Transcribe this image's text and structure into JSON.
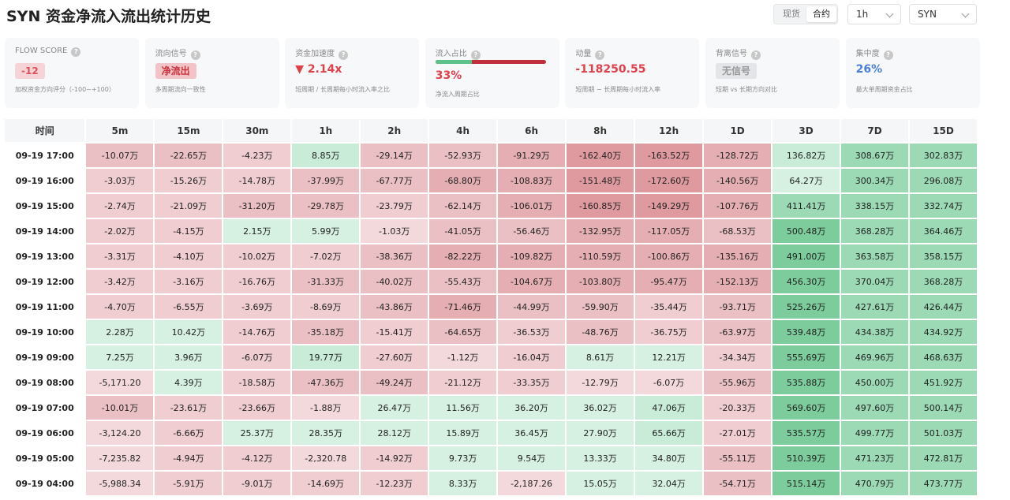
{
  "header": {
    "title": "SYN 资金净流入流出统计历史",
    "market_tabs": [
      "现货",
      "合约"
    ],
    "active_market": 1,
    "interval": "1h",
    "symbol": "SYN"
  },
  "cards": [
    {
      "label": "FLOW SCORE",
      "value": "-12",
      "sub": "加权资金方向评分（-100~+100）",
      "kind": "badge",
      "color": "#e0505a",
      "bg": "#f6d3d6"
    },
    {
      "label": "流向信号",
      "value": "净流出",
      "sub": "多周期流向一致性",
      "kind": "badge",
      "color": "#c8303a",
      "bg": "#f3c4c7"
    },
    {
      "label": "资金加速度",
      "value": "▼ 2.14x",
      "sub": "短周期 / 长周期每小时流入率之比",
      "kind": "text",
      "color": "#e0404a"
    },
    {
      "label": "流入占比",
      "value": "33%",
      "sub": "净流入周期占比",
      "kind": "ratio",
      "color": "#e0404a",
      "ratio": 0.33
    },
    {
      "label": "动量",
      "value": "-118250.55",
      "sub": "短周期 − 长周期每小时流入率",
      "kind": "text",
      "color": "#e0404a"
    },
    {
      "label": "背离信号",
      "value": "无信号",
      "sub": "短期 vs 长期方向对比",
      "kind": "badge",
      "color": "#999999",
      "bg": "#e4e5e8"
    },
    {
      "label": "集中度",
      "value": "26%",
      "sub": "最大单周期资金占比",
      "kind": "text",
      "color": "#4a7fd6"
    }
  ],
  "table": {
    "headers": [
      "时间",
      "5m",
      "15m",
      "30m",
      "1h",
      "2h",
      "4h",
      "6h",
      "8h",
      "12h",
      "1D",
      "3D",
      "7D",
      "15D"
    ],
    "rows": [
      {
        "time": "09-19 17:00",
        "cells": [
          "-10.07万",
          "-22.65万",
          "-4.23万",
          "8.85万",
          "-29.14万",
          "-52.93万",
          "-91.29万",
          "-162.40万",
          "-163.52万",
          "-128.72万",
          "136.82万",
          "308.67万",
          "302.83万"
        ],
        "levels": [
          -3,
          -3,
          -2,
          2,
          -3,
          -3,
          -4,
          -5,
          -5,
          -4,
          2,
          4,
          4
        ]
      },
      {
        "time": "09-19 16:00",
        "cells": [
          "-3.03万",
          "-15.26万",
          "-14.78万",
          "-37.99万",
          "-67.77万",
          "-68.80万",
          "-108.83万",
          "-151.48万",
          "-172.60万",
          "-140.56万",
          "64.27万",
          "300.34万",
          "296.08万"
        ],
        "levels": [
          -2,
          -2,
          -2,
          -3,
          -3,
          -4,
          -4,
          -5,
          -5,
          -4,
          1,
          4,
          4
        ]
      },
      {
        "time": "09-19 15:00",
        "cells": [
          "-2.74万",
          "-21.09万",
          "-31.20万",
          "-29.78万",
          "-23.79万",
          "-62.14万",
          "-106.01万",
          "-160.85万",
          "-149.29万",
          "-107.76万",
          "411.41万",
          "338.15万",
          "332.74万"
        ],
        "levels": [
          -2,
          -2,
          -3,
          -3,
          -2,
          -3,
          -4,
          -5,
          -5,
          -4,
          4,
          4,
          4
        ]
      },
      {
        "time": "09-19 14:00",
        "cells": [
          "-2.02万",
          "-4.15万",
          "2.15万",
          "5.99万",
          "-1.03万",
          "-41.05万",
          "-56.46万",
          "-132.95万",
          "-117.05万",
          "-68.53万",
          "500.48万",
          "368.28万",
          "364.46万"
        ],
        "levels": [
          -2,
          -2,
          1,
          1,
          -1,
          -3,
          -3,
          -4,
          -4,
          -3,
          5,
          4,
          4
        ]
      },
      {
        "time": "09-19 13:00",
        "cells": [
          "-3.31万",
          "-4.10万",
          "-10.02万",
          "-7.02万",
          "-38.36万",
          "-82.22万",
          "-109.82万",
          "-110.59万",
          "-100.86万",
          "-135.16万",
          "491.00万",
          "363.58万",
          "358.15万"
        ],
        "levels": [
          -2,
          -2,
          -2,
          -2,
          -3,
          -4,
          -4,
          -4,
          -4,
          -4,
          5,
          4,
          4
        ]
      },
      {
        "time": "09-19 12:00",
        "cells": [
          "-3.42万",
          "-3.16万",
          "-16.76万",
          "-31.33万",
          "-40.02万",
          "-55.43万",
          "-104.67万",
          "-103.80万",
          "-95.47万",
          "-152.13万",
          "456.30万",
          "370.04万",
          "368.28万"
        ],
        "levels": [
          -2,
          -2,
          -2,
          -3,
          -3,
          -3,
          -4,
          -4,
          -4,
          -4,
          5,
          4,
          4
        ]
      },
      {
        "time": "09-19 11:00",
        "cells": [
          "-4.70万",
          "-6.55万",
          "-3.69万",
          "-8.69万",
          "-43.86万",
          "-71.46万",
          "-44.99万",
          "-59.90万",
          "-35.44万",
          "-93.71万",
          "525.26万",
          "427.61万",
          "426.44万"
        ],
        "levels": [
          -2,
          -2,
          -2,
          -2,
          -3,
          -4,
          -3,
          -3,
          -2,
          -3,
          5,
          4,
          4
        ]
      },
      {
        "time": "09-19 10:00",
        "cells": [
          "2.28万",
          "10.42万",
          "-14.76万",
          "-35.18万",
          "-15.41万",
          "-64.65万",
          "-36.53万",
          "-48.76万",
          "-36.75万",
          "-63.97万",
          "539.48万",
          "434.38万",
          "434.92万"
        ],
        "levels": [
          1,
          1,
          -2,
          -3,
          -2,
          -3,
          -2,
          -3,
          -2,
          -3,
          5,
          4,
          4
        ]
      },
      {
        "time": "09-19 09:00",
        "cells": [
          "7.25万",
          "3.96万",
          "-6.07万",
          "19.77万",
          "-27.60万",
          "-1.12万",
          "-16.04万",
          "8.61万",
          "12.21万",
          "-34.34万",
          "555.69万",
          "469.96万",
          "468.63万"
        ],
        "levels": [
          1,
          1,
          -2,
          2,
          -2,
          -1,
          -2,
          1,
          1,
          -2,
          5,
          4,
          4
        ]
      },
      {
        "time": "09-19 08:00",
        "cells": [
          "-5,171.20",
          "4.39万",
          "-18.58万",
          "-47.36万",
          "-49.24万",
          "-21.12万",
          "-33.35万",
          "-12.79万",
          "-6.07万",
          "-55.96万",
          "535.88万",
          "450.00万",
          "451.92万"
        ],
        "levels": [
          -1,
          1,
          -2,
          -3,
          -3,
          -2,
          -2,
          -1,
          -1,
          -3,
          5,
          4,
          4
        ]
      },
      {
        "time": "09-19 07:00",
        "cells": [
          "-10.01万",
          "-23.61万",
          "-23.66万",
          "-1.88万",
          "26.47万",
          "11.56万",
          "36.20万",
          "36.02万",
          "47.06万",
          "-20.33万",
          "569.60万",
          "497.60万",
          "500.14万"
        ],
        "levels": [
          -3,
          -2,
          -2,
          -1,
          1,
          1,
          1,
          1,
          2,
          -2,
          5,
          4,
          4
        ]
      },
      {
        "time": "09-19 06:00",
        "cells": [
          "-3,124.20",
          "-6.66万",
          "25.37万",
          "28.35万",
          "28.12万",
          "15.89万",
          "36.45万",
          "27.90万",
          "65.66万",
          "-27.01万",
          "535.57万",
          "499.77万",
          "501.03万"
        ],
        "levels": [
          -1,
          -2,
          1,
          1,
          1,
          1,
          1,
          1,
          2,
          -2,
          5,
          4,
          4
        ]
      },
      {
        "time": "09-19 05:00",
        "cells": [
          "-7,235.82",
          "-4.94万",
          "-4.12万",
          "-2,320.78",
          "-14.92万",
          "9.73万",
          "9.54万",
          "13.33万",
          "34.80万",
          "-55.11万",
          "510.39万",
          "471.23万",
          "472.81万"
        ],
        "levels": [
          -1,
          -2,
          -2,
          -1,
          -2,
          1,
          1,
          1,
          1,
          -3,
          5,
          4,
          4
        ]
      },
      {
        "time": "09-19 04:00",
        "cells": [
          "-5,988.34",
          "-5.91万",
          "-9.01万",
          "-14.69万",
          "-12.23万",
          "8.33万",
          "-2,187.26",
          "15.05万",
          "32.04万",
          "-54.71万",
          "515.14万",
          "470.79万",
          "473.77万"
        ],
        "levels": [
          -1,
          -2,
          -2,
          -2,
          -2,
          1,
          -1,
          1,
          1,
          -3,
          5,
          4,
          4
        ]
      }
    ]
  },
  "colors": {
    "neg": [
      "#f4d9dc",
      "#efcdd0",
      "#ebc0c4",
      "#e5aeb2",
      "#de9a9f"
    ],
    "pos": [
      "#d6f1e2",
      "#c8ecd7",
      "#b2e4c6",
      "#9bdab5",
      "#7ccc9c"
    ]
  }
}
